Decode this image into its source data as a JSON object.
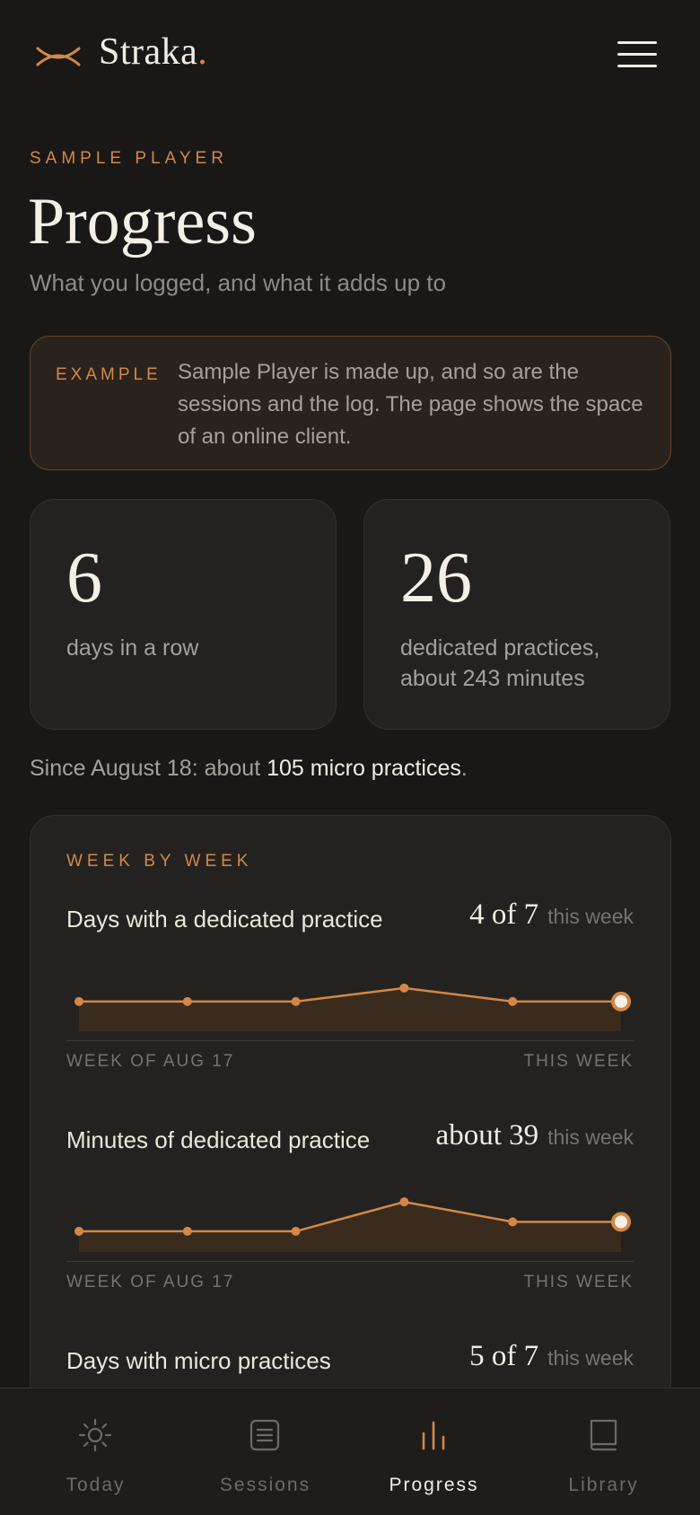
{
  "brand": {
    "name": "Straka",
    "dot": ".",
    "accent": "#D38847"
  },
  "header": {
    "menu_icon": "hamburger-menu-icon"
  },
  "intro": {
    "eyebrow": "SAMPLE PLAYER",
    "title": "Progress",
    "subtitle": "What you logged, and what it adds up to"
  },
  "notice": {
    "tag": "EXAMPLE",
    "text": "Sample Player is made up, and so are the sessions and the log. The page shows the space of an online client."
  },
  "stats": [
    {
      "value": "6",
      "label": "days in a row"
    },
    {
      "value": "26",
      "label": "dedicated practices, about 243 minutes"
    }
  ],
  "since": {
    "prefix": "Since August 18: about ",
    "highlight": "105 micro practices",
    "suffix": "."
  },
  "week_by_week": {
    "title": "WEEK BY WEEK",
    "metrics": [
      {
        "label": "Days with a dedicated practice",
        "value": "4 of 7",
        "unit": "this week",
        "axis_start": "WEEK OF AUG 17",
        "axis_end": "THIS WEEK"
      },
      {
        "label": "Minutes of dedicated practice",
        "value": "about 39",
        "unit": "this week",
        "axis_start": "WEEK OF AUG 17",
        "axis_end": "THIS WEEK"
      },
      {
        "label": "Days with micro practices",
        "value": "5 of 7",
        "unit": "this week"
      }
    ]
  },
  "chart_data": [
    {
      "type": "area",
      "title": "Days with a dedicated practice",
      "x": [
        "WEEK OF AUG 17",
        "",
        "",
        "",
        "",
        "THIS WEEK"
      ],
      "values": [
        3,
        3,
        3,
        4,
        3,
        3
      ],
      "ylim": [
        0,
        7
      ],
      "grid": false,
      "color": "#D38847"
    },
    {
      "type": "area",
      "title": "Minutes of dedicated practice",
      "x": [
        "WEEK OF AUG 17",
        "",
        "",
        "",
        "",
        "THIS WEEK"
      ],
      "values": [
        30,
        30,
        30,
        58,
        39,
        39
      ],
      "ylim": [
        0,
        90
      ],
      "grid": false,
      "color": "#D38847"
    }
  ],
  "nav": {
    "items": [
      {
        "label": "Today",
        "icon": "sun-icon",
        "active": false
      },
      {
        "label": "Sessions",
        "icon": "document-icon",
        "active": false
      },
      {
        "label": "Progress",
        "icon": "bar-chart-icon",
        "active": true
      },
      {
        "label": "Library",
        "icon": "book-icon",
        "active": false
      }
    ]
  }
}
